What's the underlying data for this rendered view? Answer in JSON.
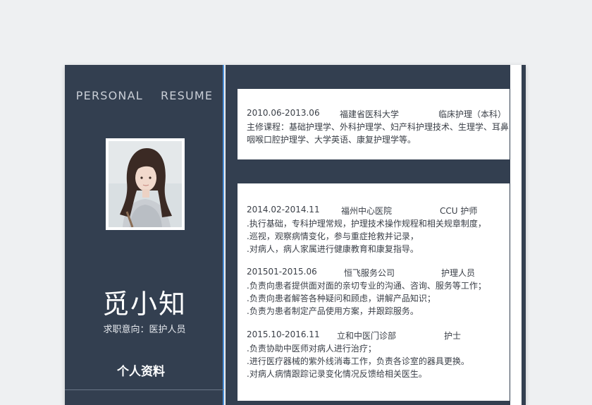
{
  "sidebar": {
    "personal_resume": "PERSONAL    RESUME",
    "name": "觅小知",
    "job_intent": "求职意向：医护人员",
    "section_title": "个人资料"
  },
  "education": {
    "period": "2010.06-2013.06",
    "school": "福建省医科大学",
    "major": "临床护理（本科）",
    "courses_line1": "主修课程：基础护理学、外科护理学、妇产科护理技术、生理学、耳鼻",
    "courses_line2": "咽喉口腔护理学、大学英语、康复护理学等。"
  },
  "experience": [
    {
      "period": "2014.02-2014.11",
      "org": "福州中心医院",
      "role": "CCU 护师",
      "lines": [
        ".执行基础，专科护理常规，护理技术操作规程和相关规章制度，",
        ".巡视，观察病情变化，参与重症抢救并记录，",
        ".对病人，病人家属进行健康教育和康复指导。"
      ]
    },
    {
      "period": "201501-2015.06",
      "org": "恒飞服务公司",
      "role": "护理人员",
      "lines": [
        ".负责向患者提供面对面的亲切专业的沟通、咨询、服务等工作；",
        ".负责向患者解答各种疑问和顾虑，讲解产品知识；",
        ".负责为患者制定产品使用方案，并跟踪服务。"
      ]
    },
    {
      "period": "2015.10-2016.11",
      "org": "立和中医门诊部",
      "role": "护士",
      "lines": [
        ".负责协助中医师对病人进行治疗；",
        ".进行医疗器械的紫外线消毒工作，负责各诊室的器具更换。",
        ".对病人病情跟踪记录变化情况反馈给相关医生。"
      ]
    }
  ],
  "colors": {
    "navy": "#333f50",
    "accent": "#4a90d9"
  }
}
